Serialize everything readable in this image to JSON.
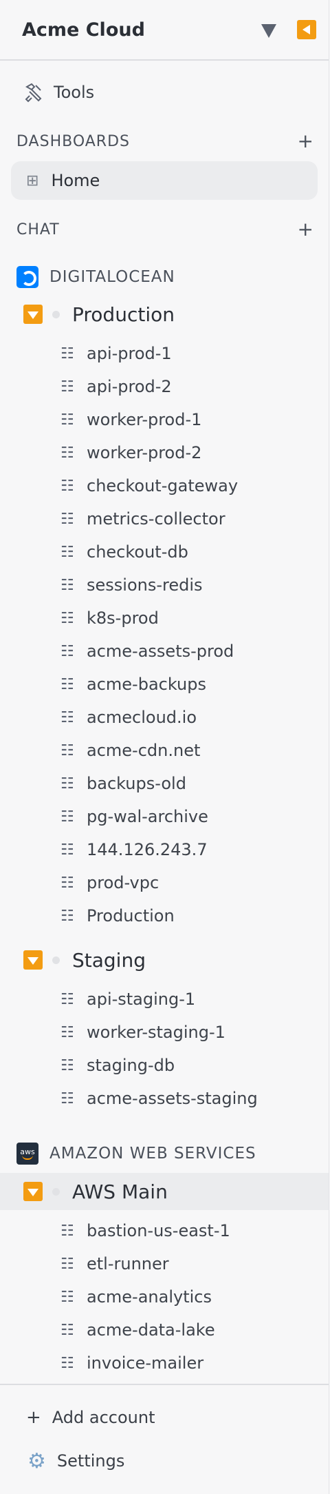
{
  "header": {
    "title": "Acme Cloud"
  },
  "tools": {
    "label": "Tools"
  },
  "dashboards": {
    "title": "DASHBOARDS",
    "home_label": "Home"
  },
  "chat": {
    "title": "CHAT"
  },
  "providers": [
    {
      "name": "DIGITALOCEAN",
      "groups": [
        {
          "name": "Production",
          "items": [
            "api-prod-1",
            "api-prod-2",
            "worker-prod-1",
            "worker-prod-2",
            "checkout-gateway",
            "metrics-collector",
            "checkout-db",
            "sessions-redis",
            "k8s-prod",
            "acme-assets-prod",
            "acme-backups",
            "acmecloud.io",
            "acme-cdn.net",
            "backups-old",
            "pg-wal-archive",
            "144.126.243.7",
            "prod-vpc",
            "Production"
          ]
        },
        {
          "name": "Staging",
          "items": [
            "api-staging-1",
            "worker-staging-1",
            "staging-db",
            "acme-assets-staging"
          ]
        }
      ]
    },
    {
      "name": "AMAZON WEB SERVICES",
      "groups": [
        {
          "name": "AWS Main",
          "items": [
            "bastion-us-east-1",
            "etl-runner",
            "acme-analytics",
            "acme-data-lake",
            "invoice-mailer"
          ]
        }
      ]
    }
  ],
  "footer": {
    "add_account_label": "Add account",
    "settings_label": "Settings"
  },
  "colors": {
    "accent": "#f39c12",
    "digitalocean": "#0080ff",
    "aws": "#232f3e",
    "active_bg": "#ebecee"
  }
}
